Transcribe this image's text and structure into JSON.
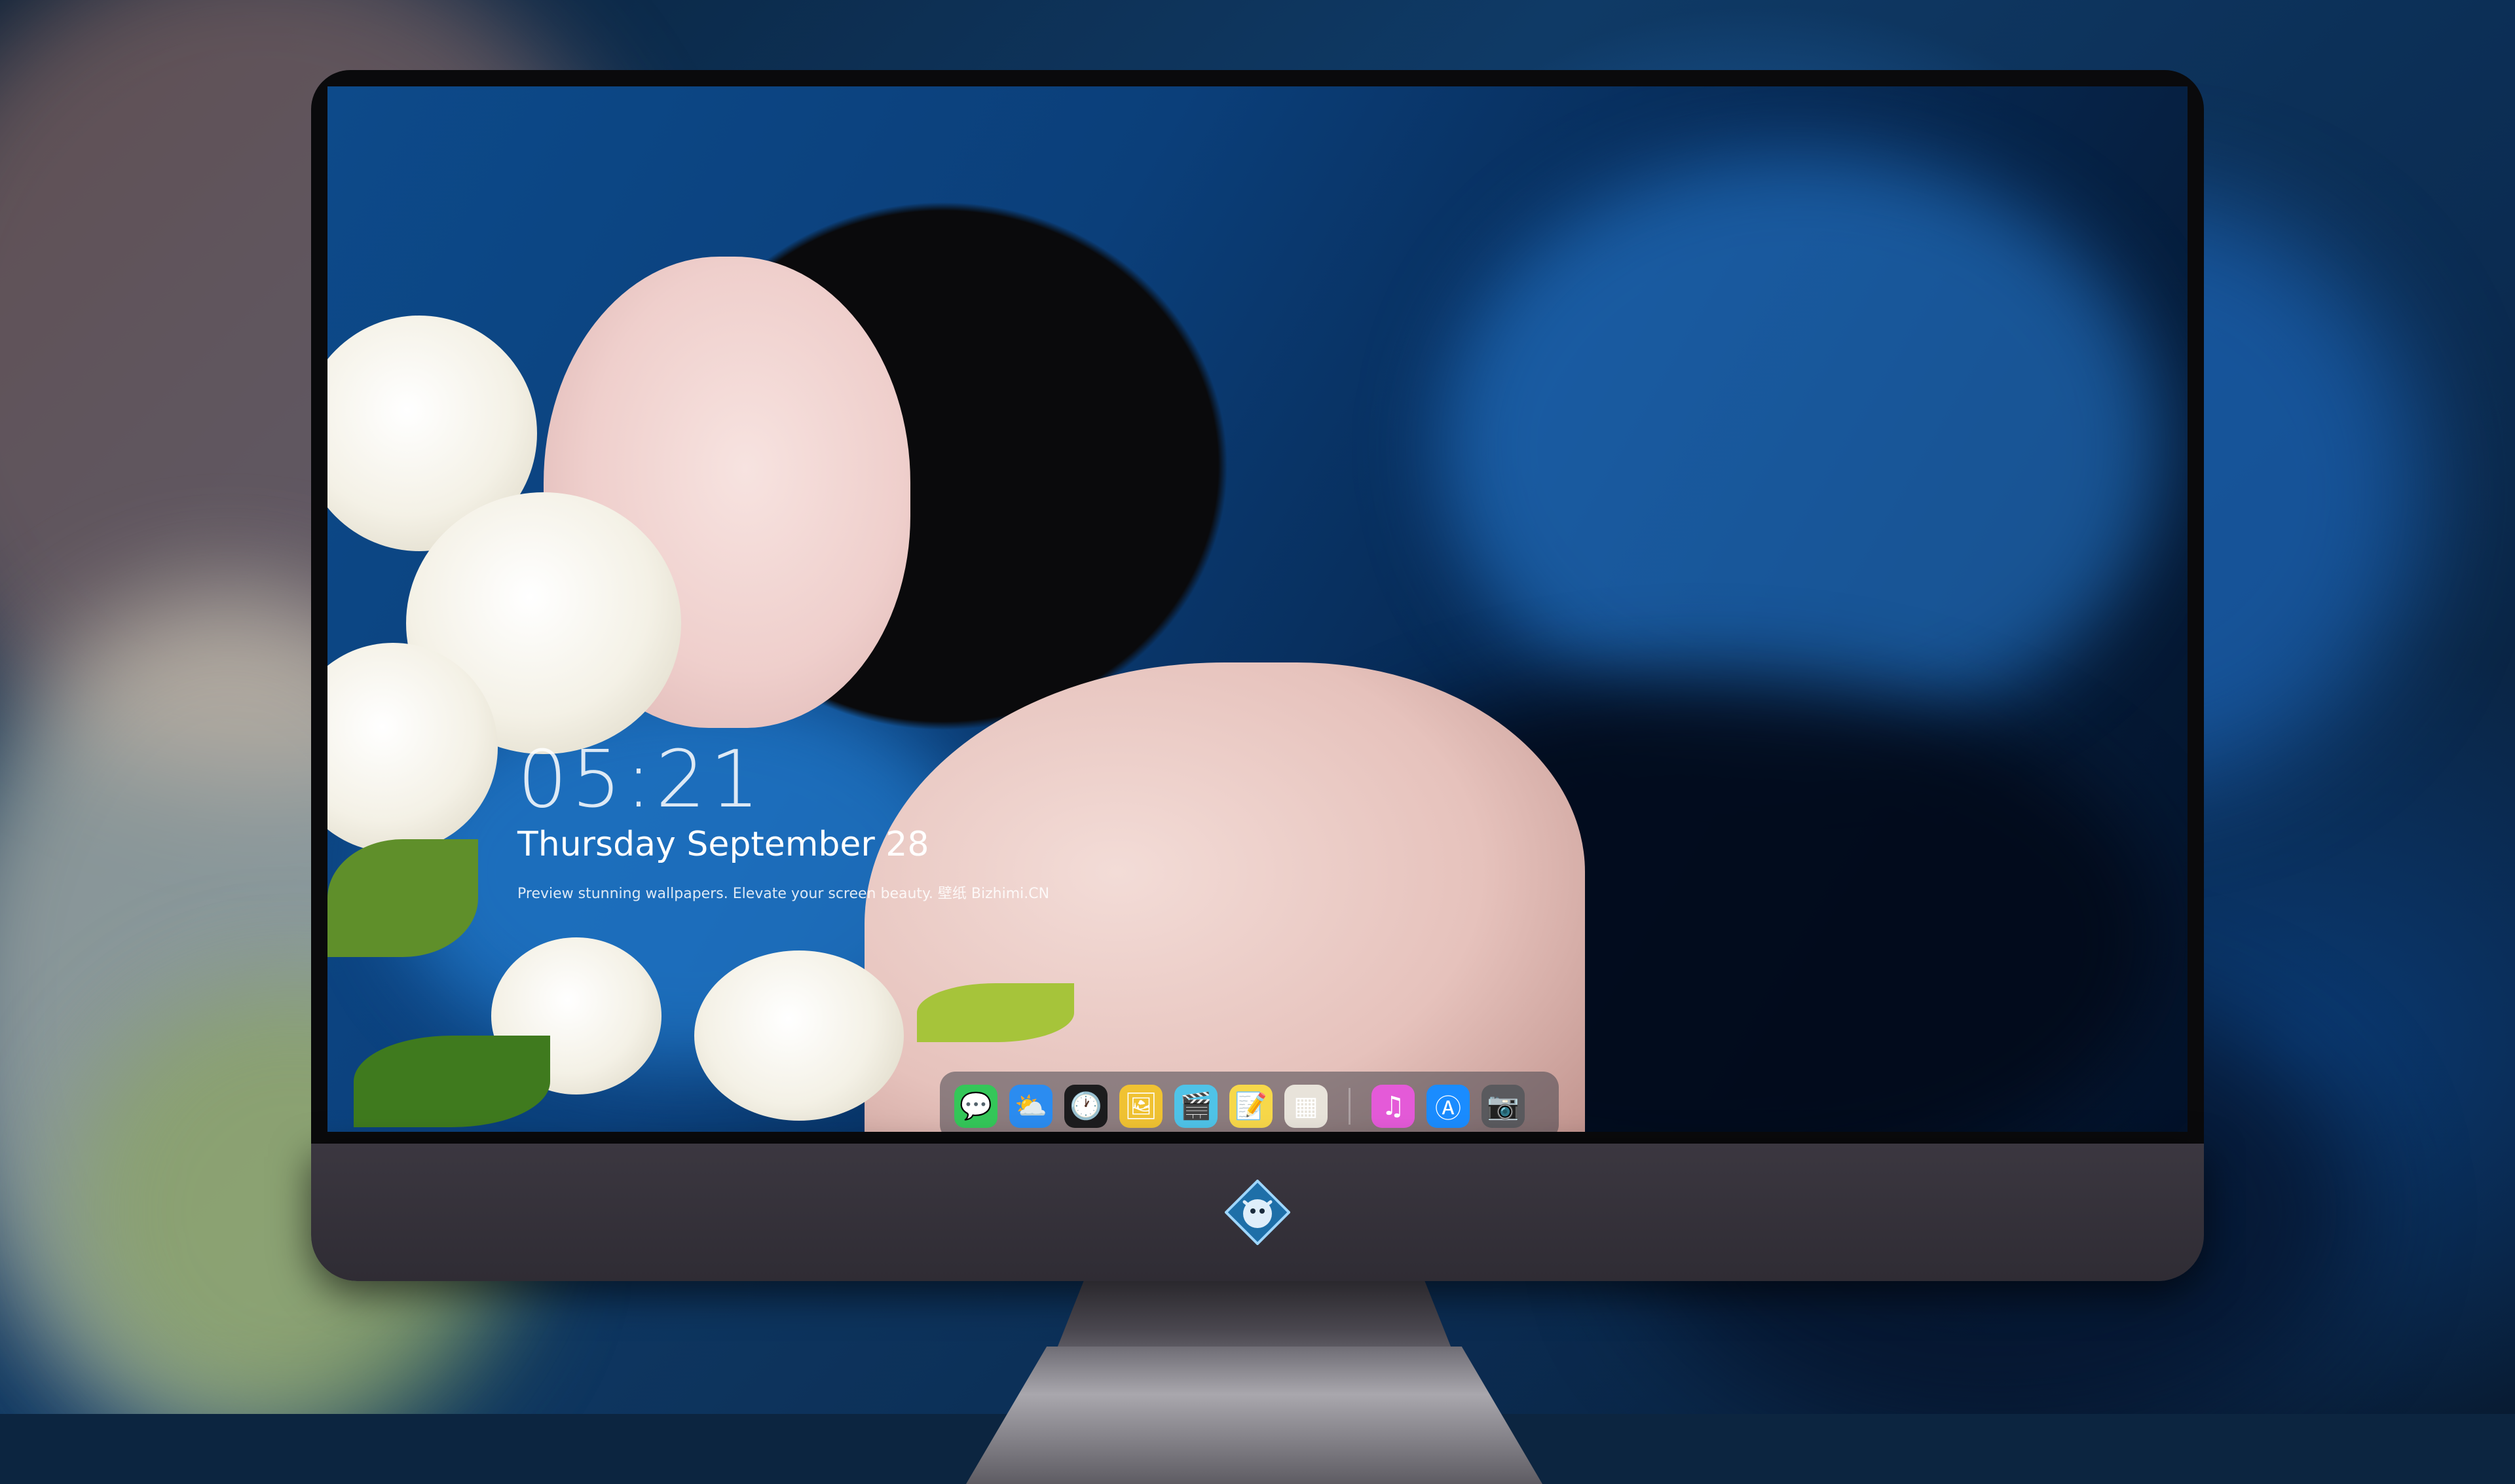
{
  "lock_screen": {
    "time": "05:21",
    "date": "Thursday September  28",
    "tagline": "Preview stunning wallpapers. Elevate your screen beauty. 壁纸  Bizhimi.CN"
  },
  "dock": {
    "apps": [
      {
        "name": "messages-icon",
        "glyph": "💬",
        "color": "#34c759"
      },
      {
        "name": "weather-icon",
        "glyph": "⛅",
        "color": "#2b8cf0"
      },
      {
        "name": "clock-icon",
        "glyph": "🕐",
        "color": "#1c1c1e"
      },
      {
        "name": "preview-icon",
        "glyph": "🖼",
        "color": "#f0c232"
      },
      {
        "name": "videos-icon",
        "glyph": "🎬",
        "color": "#4fc3e8"
      },
      {
        "name": "notes-icon",
        "glyph": "📝",
        "color": "#f7d84a"
      },
      {
        "name": "photos-grid-icon",
        "glyph": "▦",
        "color": "#e8e3da"
      },
      {
        "name": "music-icon",
        "glyph": "♫",
        "color": "#e45ad8"
      },
      {
        "name": "app-store-icon",
        "glyph": "Ⓐ",
        "color": "#1a8cff"
      },
      {
        "name": "camera-icon",
        "glyph": "📷",
        "color": "#5a5a5e"
      }
    ]
  },
  "colors": {
    "accent": "#1a8cff",
    "chin": "#3b3740"
  }
}
